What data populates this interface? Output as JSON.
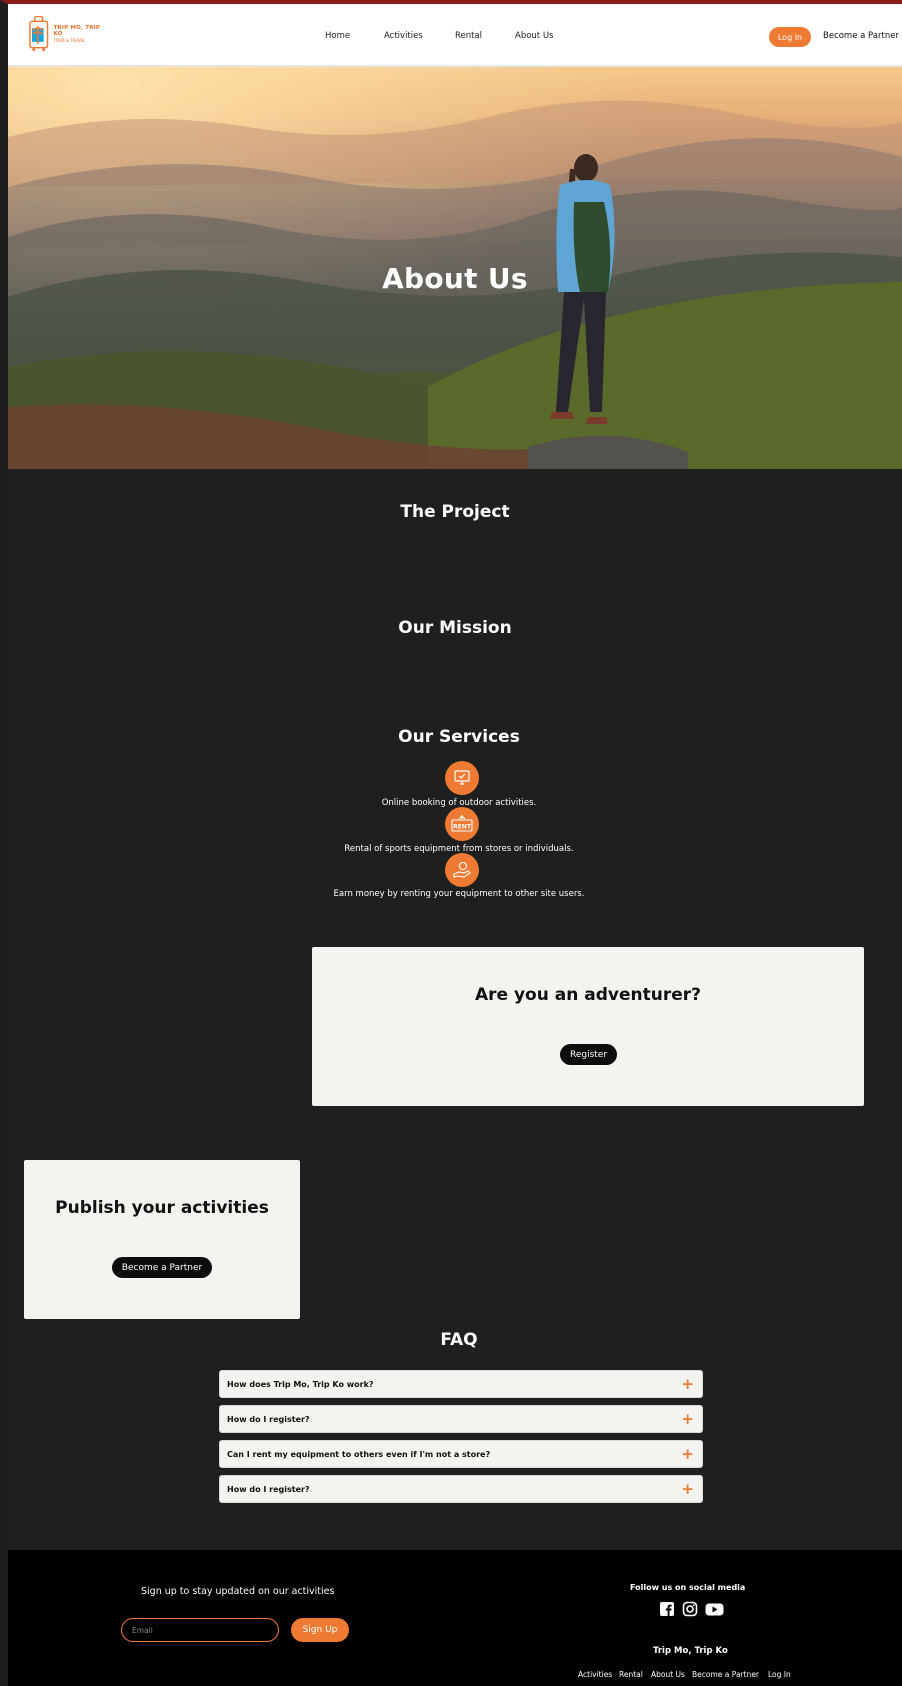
{
  "brand": {
    "name": "TRIP MO, TRIP KO",
    "tagline": "TOUR & TRAVEL",
    "accent": "#ef7a33"
  },
  "nav": {
    "items": [
      "Home",
      "Activities",
      "Rental",
      "About Us"
    ],
    "login_label": "Log In",
    "partner_label": "Become a Partner"
  },
  "hero": {
    "title": "About Us"
  },
  "sections": {
    "project_title": "The Project",
    "mission_title": "Our Mission",
    "services_title": "Our Services"
  },
  "services": [
    {
      "icon": "computer-booking-icon",
      "text": "Online booking of outdoor activities."
    },
    {
      "icon": "rent-sign-icon",
      "text": "Rental of sports equipment from stores or individuals.",
      "badge": "RENT"
    },
    {
      "icon": "money-hand-icon",
      "text": "Earn money by renting your equipment to other site users."
    }
  ],
  "adventurer_card": {
    "title": "Are you an adventurer?",
    "button_label": "Register"
  },
  "partner_card": {
    "title": "Publish your activities",
    "button_label": "Become a Partner"
  },
  "faq": {
    "title": "FAQ",
    "items": [
      "How does Trip Mo, Trip Ko work?",
      "How do I register?",
      "Can I rent my equipment to others even if I'm not a store?",
      "How do I register?"
    ],
    "toggle": "+"
  },
  "footer": {
    "signup_text": "Sign up to stay updated on our activities",
    "email_placeholder": "Email",
    "signup_button": "Sign Up",
    "follow_title": "Follow us on social media",
    "social": [
      "facebook-icon",
      "instagram-icon",
      "youtube-icon"
    ],
    "brand_name": "Trip Mo, Trip Ko",
    "links": [
      "Activities",
      "Rental",
      "About Us",
      "Become a Partner",
      "Log In"
    ]
  }
}
